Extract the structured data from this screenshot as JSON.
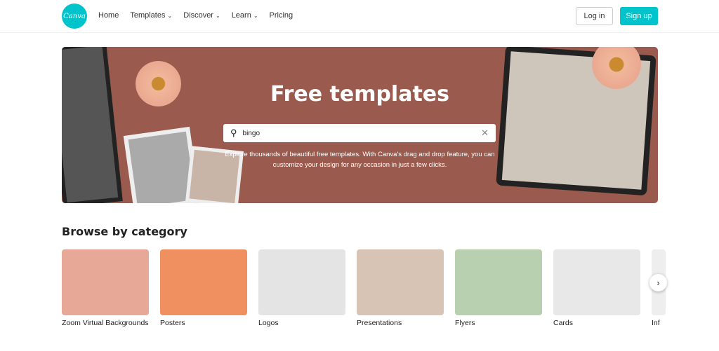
{
  "header": {
    "logo": "Canva",
    "nav": [
      {
        "label": "Home"
      },
      {
        "label": "Templates",
        "chevron": true
      },
      {
        "label": "Discover",
        "chevron": true
      },
      {
        "label": "Learn",
        "chevron": true
      },
      {
        "label": "Pricing"
      }
    ],
    "login": "Log in",
    "signup": "Sign up"
  },
  "hero": {
    "title": "Free templates",
    "search_value": "bingo",
    "description_line1": "Explore thousands of beautiful free templates. With Canva's drag and drop feature, you can",
    "description_line2": "customize your design for any occasion in just a few clicks."
  },
  "browse": {
    "title": "Browse by category",
    "categories": [
      {
        "label": "Zoom Virtual Backgrounds",
        "color": "#e8a898"
      },
      {
        "label": "Posters",
        "color": "#f09060"
      },
      {
        "label": "Logos",
        "color": "#e4e4e4"
      },
      {
        "label": "Presentations",
        "color": "#d8c4b4"
      },
      {
        "label": "Flyers",
        "color": "#b8d0b0"
      },
      {
        "label": "Cards",
        "color": "#e8e8e8"
      },
      {
        "label": "Inf",
        "color": "#eee"
      }
    ]
  },
  "colors": {
    "accent": "#00c4cc",
    "hero_bg": "#9a5a4d"
  }
}
